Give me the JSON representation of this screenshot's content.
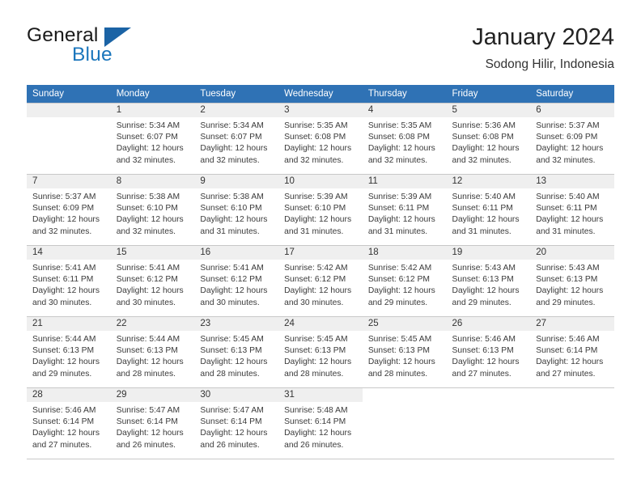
{
  "brand": {
    "name_part1": "General",
    "name_part2": "Blue",
    "flag_icon": "triangle-flag-icon",
    "accent_color": "#1b76bc"
  },
  "header": {
    "month_title": "January 2024",
    "location": "Sodong Hilir, Indonesia"
  },
  "calendar": {
    "header_bg": "#2f72b5",
    "daynum_bg": "#efefef",
    "weekdays": [
      "Sunday",
      "Monday",
      "Tuesday",
      "Wednesday",
      "Thursday",
      "Friday",
      "Saturday"
    ],
    "weeks": [
      [
        {
          "day": "",
          "sunrise": "",
          "sunset": "",
          "daylight_1": "",
          "daylight_2": "",
          "empty": true
        },
        {
          "day": "1",
          "sunrise": "Sunrise: 5:34 AM",
          "sunset": "Sunset: 6:07 PM",
          "daylight_1": "Daylight: 12 hours",
          "daylight_2": "and 32 minutes."
        },
        {
          "day": "2",
          "sunrise": "Sunrise: 5:34 AM",
          "sunset": "Sunset: 6:07 PM",
          "daylight_1": "Daylight: 12 hours",
          "daylight_2": "and 32 minutes."
        },
        {
          "day": "3",
          "sunrise": "Sunrise: 5:35 AM",
          "sunset": "Sunset: 6:08 PM",
          "daylight_1": "Daylight: 12 hours",
          "daylight_2": "and 32 minutes."
        },
        {
          "day": "4",
          "sunrise": "Sunrise: 5:35 AM",
          "sunset": "Sunset: 6:08 PM",
          "daylight_1": "Daylight: 12 hours",
          "daylight_2": "and 32 minutes."
        },
        {
          "day": "5",
          "sunrise": "Sunrise: 5:36 AM",
          "sunset": "Sunset: 6:08 PM",
          "daylight_1": "Daylight: 12 hours",
          "daylight_2": "and 32 minutes."
        },
        {
          "day": "6",
          "sunrise": "Sunrise: 5:37 AM",
          "sunset": "Sunset: 6:09 PM",
          "daylight_1": "Daylight: 12 hours",
          "daylight_2": "and 32 minutes."
        }
      ],
      [
        {
          "day": "7",
          "sunrise": "Sunrise: 5:37 AM",
          "sunset": "Sunset: 6:09 PM",
          "daylight_1": "Daylight: 12 hours",
          "daylight_2": "and 32 minutes."
        },
        {
          "day": "8",
          "sunrise": "Sunrise: 5:38 AM",
          "sunset": "Sunset: 6:10 PM",
          "daylight_1": "Daylight: 12 hours",
          "daylight_2": "and 32 minutes."
        },
        {
          "day": "9",
          "sunrise": "Sunrise: 5:38 AM",
          "sunset": "Sunset: 6:10 PM",
          "daylight_1": "Daylight: 12 hours",
          "daylight_2": "and 31 minutes."
        },
        {
          "day": "10",
          "sunrise": "Sunrise: 5:39 AM",
          "sunset": "Sunset: 6:10 PM",
          "daylight_1": "Daylight: 12 hours",
          "daylight_2": "and 31 minutes."
        },
        {
          "day": "11",
          "sunrise": "Sunrise: 5:39 AM",
          "sunset": "Sunset: 6:11 PM",
          "daylight_1": "Daylight: 12 hours",
          "daylight_2": "and 31 minutes."
        },
        {
          "day": "12",
          "sunrise": "Sunrise: 5:40 AM",
          "sunset": "Sunset: 6:11 PM",
          "daylight_1": "Daylight: 12 hours",
          "daylight_2": "and 31 minutes."
        },
        {
          "day": "13",
          "sunrise": "Sunrise: 5:40 AM",
          "sunset": "Sunset: 6:11 PM",
          "daylight_1": "Daylight: 12 hours",
          "daylight_2": "and 31 minutes."
        }
      ],
      [
        {
          "day": "14",
          "sunrise": "Sunrise: 5:41 AM",
          "sunset": "Sunset: 6:11 PM",
          "daylight_1": "Daylight: 12 hours",
          "daylight_2": "and 30 minutes."
        },
        {
          "day": "15",
          "sunrise": "Sunrise: 5:41 AM",
          "sunset": "Sunset: 6:12 PM",
          "daylight_1": "Daylight: 12 hours",
          "daylight_2": "and 30 minutes."
        },
        {
          "day": "16",
          "sunrise": "Sunrise: 5:41 AM",
          "sunset": "Sunset: 6:12 PM",
          "daylight_1": "Daylight: 12 hours",
          "daylight_2": "and 30 minutes."
        },
        {
          "day": "17",
          "sunrise": "Sunrise: 5:42 AM",
          "sunset": "Sunset: 6:12 PM",
          "daylight_1": "Daylight: 12 hours",
          "daylight_2": "and 30 minutes."
        },
        {
          "day": "18",
          "sunrise": "Sunrise: 5:42 AM",
          "sunset": "Sunset: 6:12 PM",
          "daylight_1": "Daylight: 12 hours",
          "daylight_2": "and 29 minutes."
        },
        {
          "day": "19",
          "sunrise": "Sunrise: 5:43 AM",
          "sunset": "Sunset: 6:13 PM",
          "daylight_1": "Daylight: 12 hours",
          "daylight_2": "and 29 minutes."
        },
        {
          "day": "20",
          "sunrise": "Sunrise: 5:43 AM",
          "sunset": "Sunset: 6:13 PM",
          "daylight_1": "Daylight: 12 hours",
          "daylight_2": "and 29 minutes."
        }
      ],
      [
        {
          "day": "21",
          "sunrise": "Sunrise: 5:44 AM",
          "sunset": "Sunset: 6:13 PM",
          "daylight_1": "Daylight: 12 hours",
          "daylight_2": "and 29 minutes."
        },
        {
          "day": "22",
          "sunrise": "Sunrise: 5:44 AM",
          "sunset": "Sunset: 6:13 PM",
          "daylight_1": "Daylight: 12 hours",
          "daylight_2": "and 28 minutes."
        },
        {
          "day": "23",
          "sunrise": "Sunrise: 5:45 AM",
          "sunset": "Sunset: 6:13 PM",
          "daylight_1": "Daylight: 12 hours",
          "daylight_2": "and 28 minutes."
        },
        {
          "day": "24",
          "sunrise": "Sunrise: 5:45 AM",
          "sunset": "Sunset: 6:13 PM",
          "daylight_1": "Daylight: 12 hours",
          "daylight_2": "and 28 minutes."
        },
        {
          "day": "25",
          "sunrise": "Sunrise: 5:45 AM",
          "sunset": "Sunset: 6:13 PM",
          "daylight_1": "Daylight: 12 hours",
          "daylight_2": "and 28 minutes."
        },
        {
          "day": "26",
          "sunrise": "Sunrise: 5:46 AM",
          "sunset": "Sunset: 6:13 PM",
          "daylight_1": "Daylight: 12 hours",
          "daylight_2": "and 27 minutes."
        },
        {
          "day": "27",
          "sunrise": "Sunrise: 5:46 AM",
          "sunset": "Sunset: 6:14 PM",
          "daylight_1": "Daylight: 12 hours",
          "daylight_2": "and 27 minutes."
        }
      ],
      [
        {
          "day": "28",
          "sunrise": "Sunrise: 5:46 AM",
          "sunset": "Sunset: 6:14 PM",
          "daylight_1": "Daylight: 12 hours",
          "daylight_2": "and 27 minutes."
        },
        {
          "day": "29",
          "sunrise": "Sunrise: 5:47 AM",
          "sunset": "Sunset: 6:14 PM",
          "daylight_1": "Daylight: 12 hours",
          "daylight_2": "and 26 minutes."
        },
        {
          "day": "30",
          "sunrise": "Sunrise: 5:47 AM",
          "sunset": "Sunset: 6:14 PM",
          "daylight_1": "Daylight: 12 hours",
          "daylight_2": "and 26 minutes."
        },
        {
          "day": "31",
          "sunrise": "Sunrise: 5:48 AM",
          "sunset": "Sunset: 6:14 PM",
          "daylight_1": "Daylight: 12 hours",
          "daylight_2": "and 26 minutes."
        },
        {
          "day": "",
          "sunrise": "",
          "sunset": "",
          "daylight_1": "",
          "daylight_2": "",
          "empty": true,
          "blank": true
        },
        {
          "day": "",
          "sunrise": "",
          "sunset": "",
          "daylight_1": "",
          "daylight_2": "",
          "empty": true,
          "blank": true
        },
        {
          "day": "",
          "sunrise": "",
          "sunset": "",
          "daylight_1": "",
          "daylight_2": "",
          "empty": true,
          "blank": true
        }
      ]
    ]
  }
}
